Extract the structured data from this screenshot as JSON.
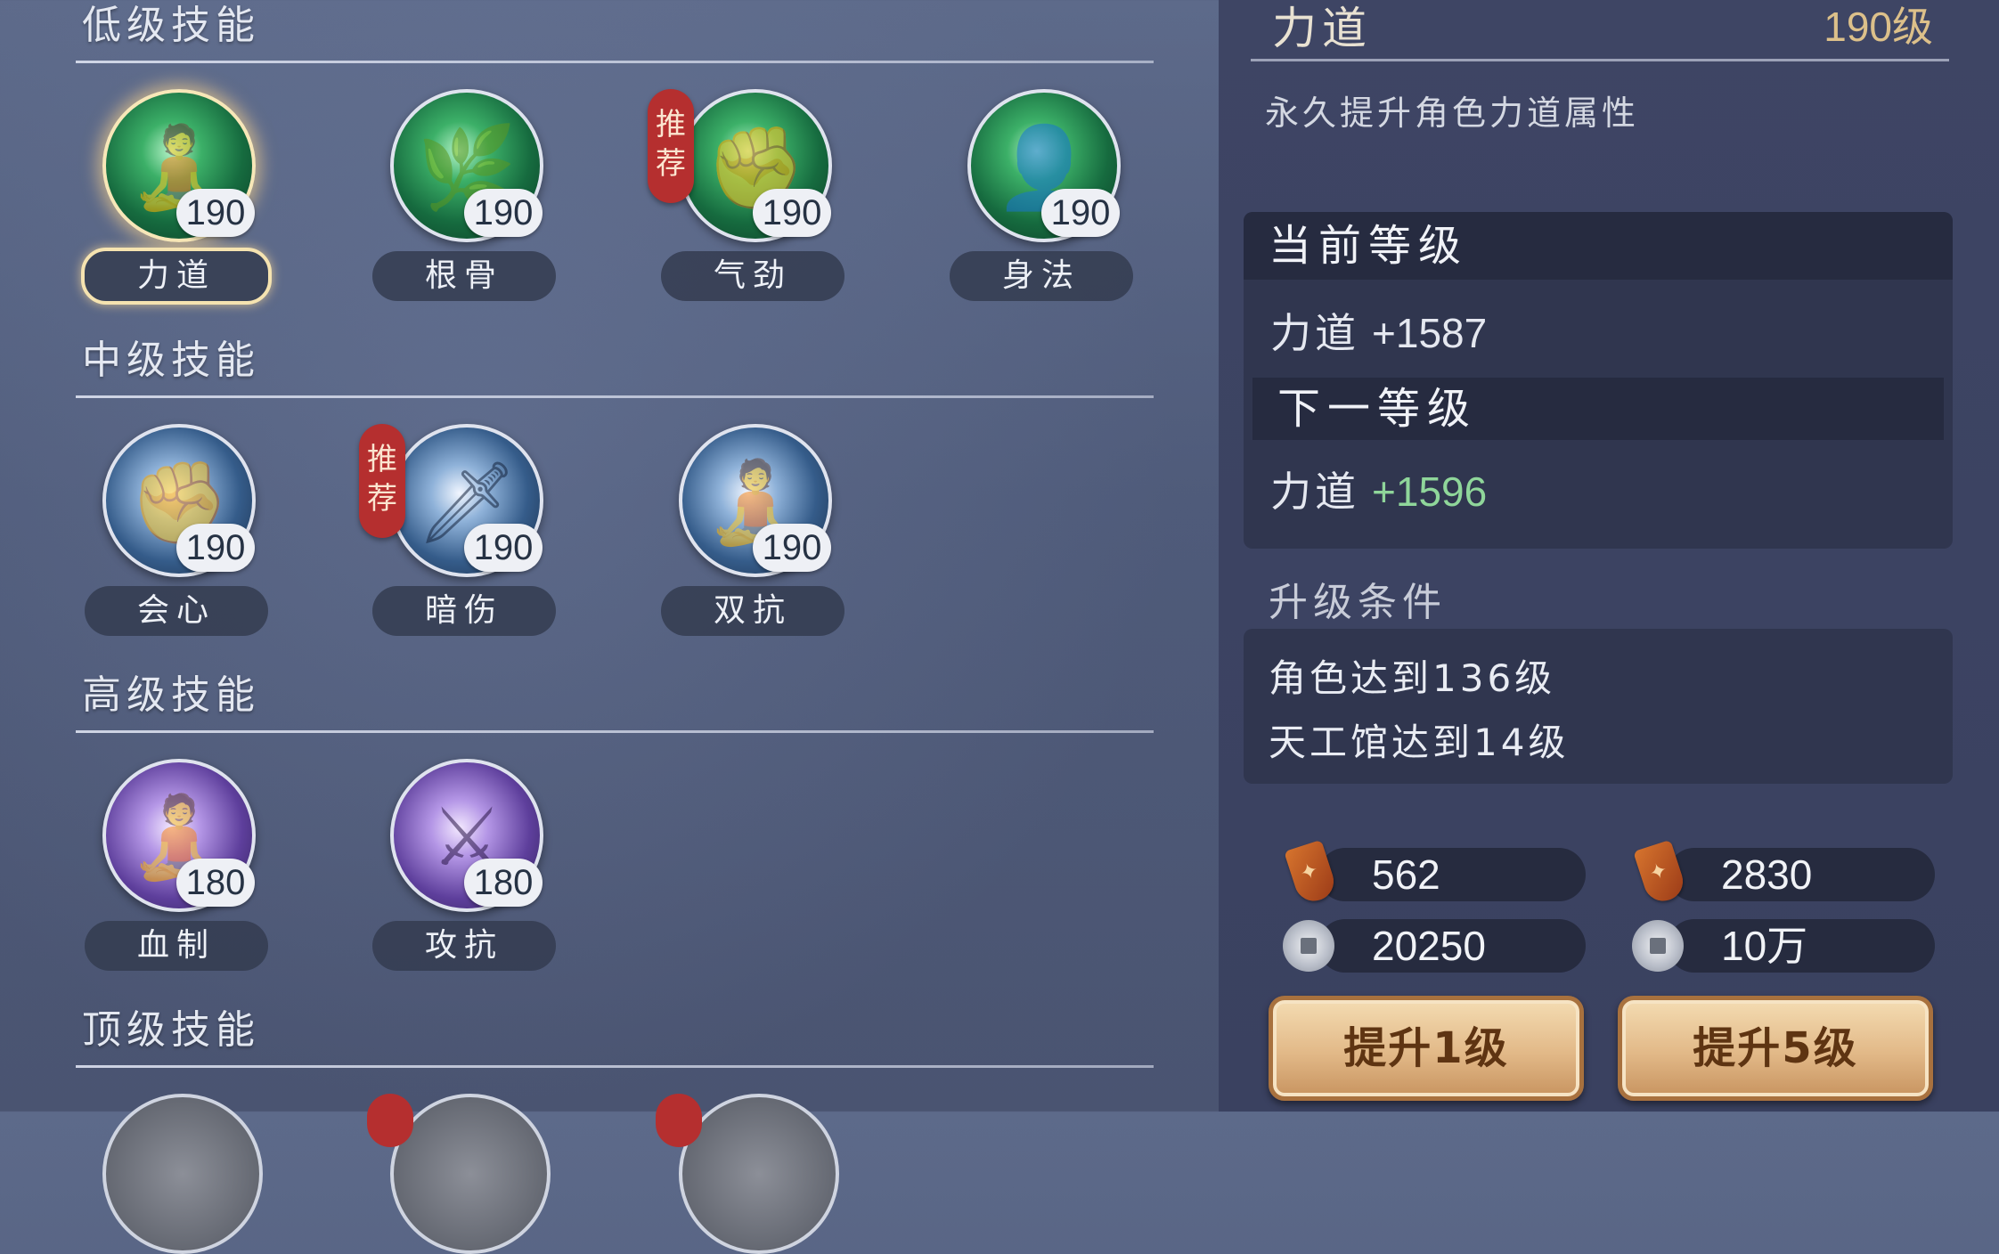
{
  "sections": {
    "low": "低级技能",
    "mid": "中级技能",
    "high": "高级技能",
    "top": "顶级技能"
  },
  "recommend_tag": "推荐",
  "skills": {
    "lidao": {
      "name": "力道",
      "level": "190",
      "selected": true
    },
    "gengu": {
      "name": "根骨",
      "level": "190"
    },
    "qijin": {
      "name": "气劲",
      "level": "190",
      "recommended": true
    },
    "shenfa": {
      "name": "身法",
      "level": "190"
    },
    "huixin": {
      "name": "会心",
      "level": "190"
    },
    "anshang": {
      "name": "暗伤",
      "level": "190",
      "recommended": true
    },
    "shuangkang": {
      "name": "双抗",
      "level": "190"
    },
    "xuezhi": {
      "name": "血制",
      "level": "180"
    },
    "gongkang": {
      "name": "攻抗",
      "level": "180"
    }
  },
  "detail": {
    "title": "力道",
    "level": "190级",
    "description": "永久提升角色力道属性",
    "current_label": "当前等级",
    "current_stat": "力道",
    "current_value": "+1587",
    "next_label": "下一等级",
    "next_stat": "力道",
    "next_value": "+1596",
    "conditions_title": "升级条件",
    "conditions": [
      "角色达到136级",
      "天工馆达到14级"
    ]
  },
  "costs": {
    "one": {
      "token": "562",
      "coin": "20250"
    },
    "five": {
      "token": "2830",
      "coin": "10万"
    }
  },
  "buttons": {
    "up1": "提升1级",
    "up5": "提升5级"
  }
}
